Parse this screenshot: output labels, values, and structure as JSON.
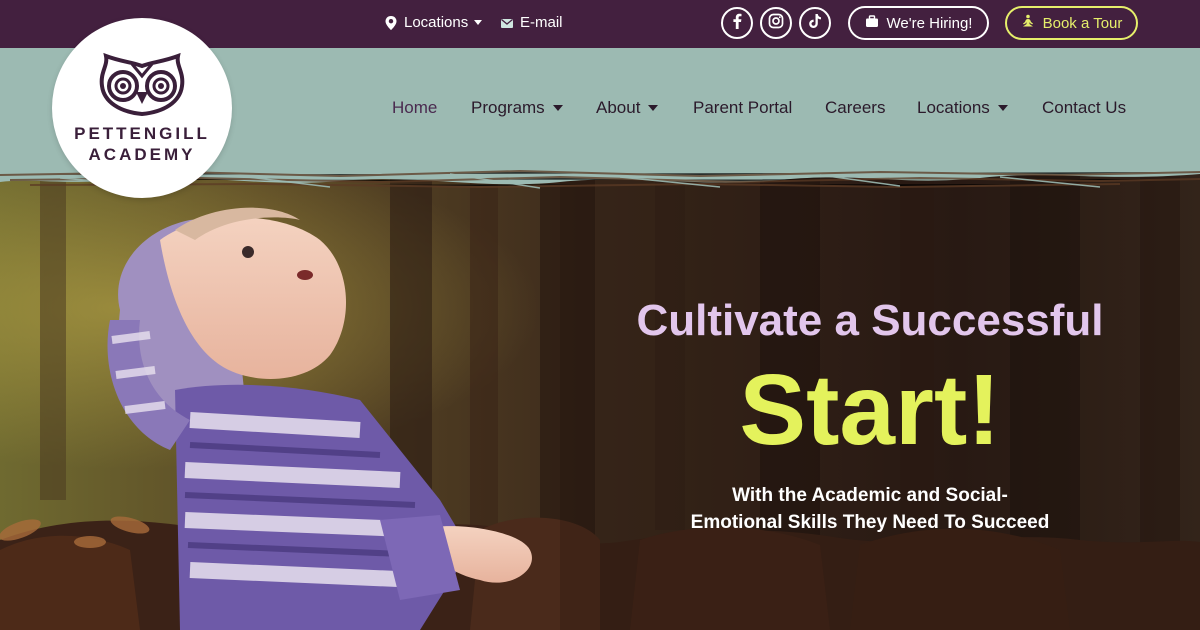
{
  "brand": {
    "logo_line1": "PETTENGILL",
    "logo_line2": "ACADEMY",
    "colors": {
      "topbar": "#43203f",
      "navbar": "#9cbab2",
      "accent_yellow": "#e4f25c",
      "accent_lilac": "#e2c6ec"
    }
  },
  "topbar": {
    "locations_label": "Locations",
    "email_label": "E-mail",
    "social": [
      {
        "icon": "facebook-icon"
      },
      {
        "icon": "instagram-icon"
      },
      {
        "icon": "tiktok-icon"
      }
    ],
    "hiring_label": "We're Hiring!",
    "tour_label": "Book a Tour"
  },
  "nav": {
    "items": [
      {
        "label": "Home",
        "active": true
      },
      {
        "label": "Programs",
        "dropdown": true
      },
      {
        "label": "About",
        "dropdown": true
      },
      {
        "label": "Parent Portal"
      },
      {
        "label": "Careers"
      },
      {
        "label": "Locations",
        "dropdown": true
      },
      {
        "label": "Contact Us"
      }
    ]
  },
  "hero": {
    "subtitle": "Cultivate a Successful",
    "headline": "Start!",
    "body_line1": "With the Academic and Social-",
    "body_line2": "Emotional Skills They Need To Succeed"
  }
}
